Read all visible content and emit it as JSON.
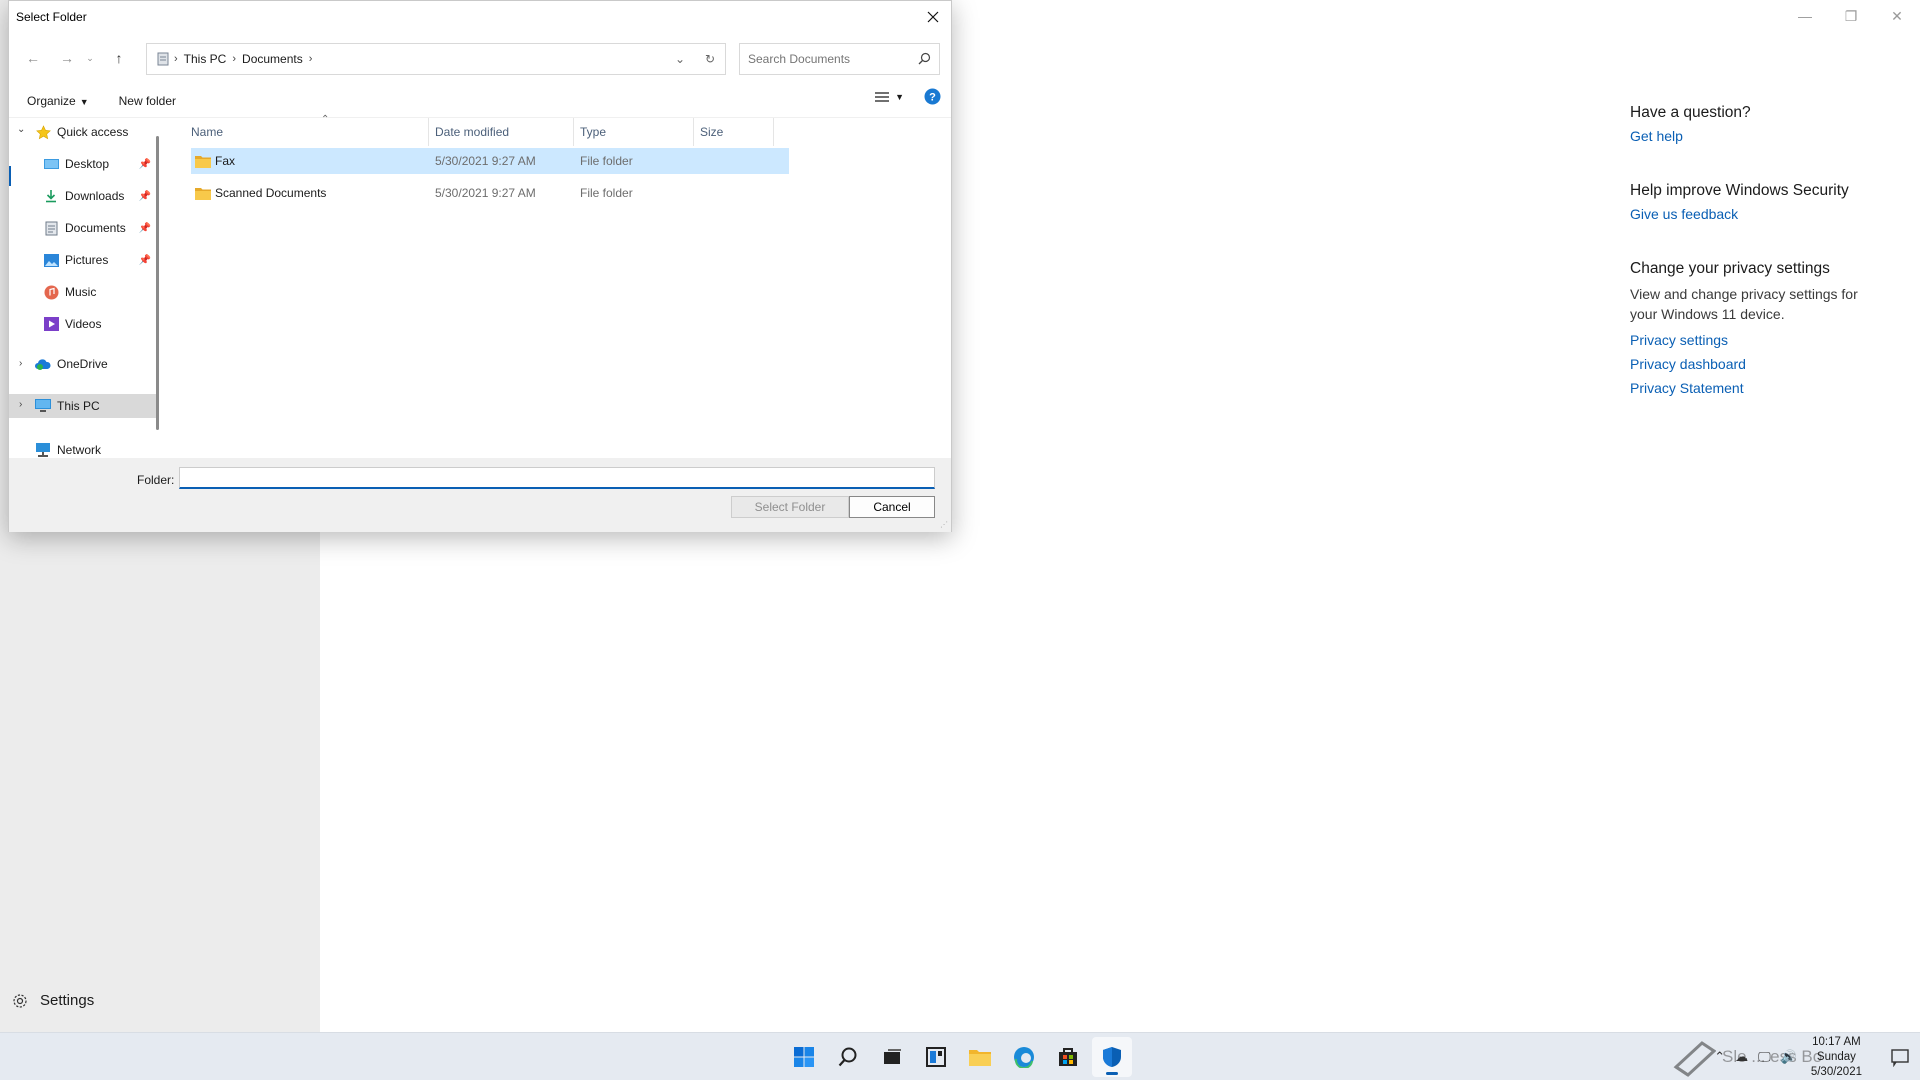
{
  "dialog": {
    "title": "Select Folder",
    "breadcrumbs": [
      "This PC",
      "Documents"
    ],
    "search_placeholder": "Search Documents",
    "toolbar": {
      "organize": "Organize",
      "new_folder": "New folder"
    },
    "nav_tree": [
      {
        "label": "Quick access",
        "icon": "star-icon"
      },
      {
        "label": "Desktop",
        "icon": "desktop-folder-icon",
        "pinned": true
      },
      {
        "label": "Downloads",
        "icon": "downloads-icon",
        "pinned": true
      },
      {
        "label": "Documents",
        "icon": "documents-icon",
        "pinned": true
      },
      {
        "label": "Pictures",
        "icon": "pictures-icon",
        "pinned": true
      },
      {
        "label": "Music",
        "icon": "music-icon"
      },
      {
        "label": "Videos",
        "icon": "videos-icon"
      },
      {
        "label": "OneDrive",
        "icon": "onedrive-icon"
      },
      {
        "label": "This PC",
        "icon": "computer-icon",
        "selected": true
      },
      {
        "label": "Network",
        "icon": "network-icon"
      }
    ],
    "columns": [
      "Name",
      "Date modified",
      "Type",
      "Size"
    ],
    "files": [
      {
        "name": "Fax",
        "date": "5/30/2021 9:27 AM",
        "type": "File folder",
        "size": ""
      },
      {
        "name": "Scanned Documents",
        "date": "5/30/2021 9:27 AM",
        "type": "File folder",
        "size": ""
      }
    ],
    "folder_label": "Folder:",
    "folder_value": "",
    "select_button": "Select Folder",
    "cancel_button": "Cancel"
  },
  "app": {
    "settings_label": "Settings",
    "help_panel": {
      "question_heading": "Have a question?",
      "get_help": "Get help",
      "improve_heading": "Help improve Windows Security",
      "feedback": "Give us feedback",
      "privacy_heading": "Change your privacy settings",
      "privacy_desc": "View and change privacy settings for your Windows 11 device.",
      "privacy_settings": "Privacy settings",
      "privacy_dashboard": "Privacy dashboard",
      "privacy_statement": "Privacy Statement"
    }
  },
  "taskbar": {
    "icons": [
      "windows-start-icon",
      "search-icon",
      "task-view-icon",
      "widgets-icon",
      "file-explorer-icon",
      "edge-icon",
      "store-icon",
      "windows-security-icon"
    ],
    "time": "10:17 AM",
    "day": "Sunday",
    "date": "5/30/2021",
    "watermark": "Sle ... ess Bo"
  },
  "colors": {
    "accent": "#0a5fb4",
    "selection": "#cce8ff",
    "folder": "#f5c84c"
  }
}
